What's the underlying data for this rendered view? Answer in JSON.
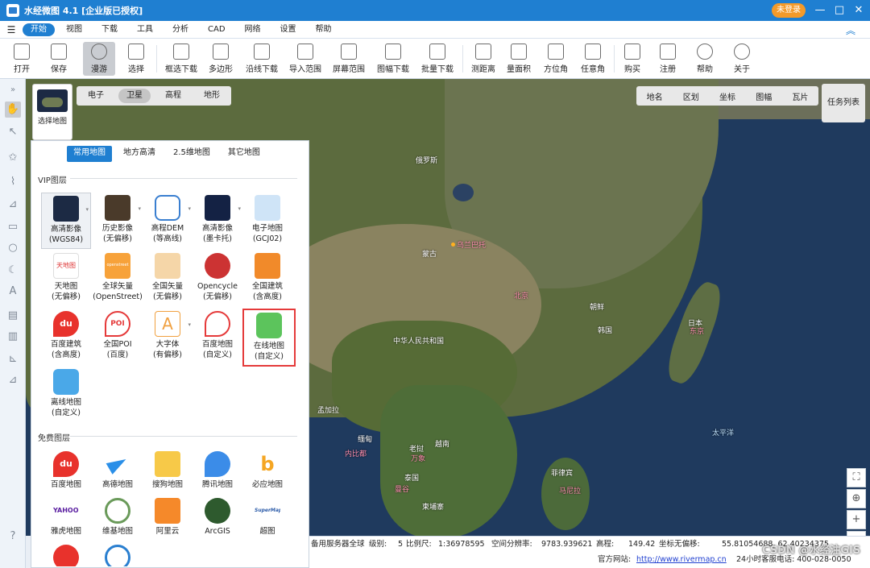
{
  "title": "水经微图 4.1 [企业版已授权]",
  "login": "未登录",
  "menu": [
    "开始",
    "视图",
    "下载",
    "工具",
    "分析",
    "CAD",
    "网络",
    "设置",
    "帮助"
  ],
  "toolbar": [
    "打开",
    "保存",
    "漫游",
    "选择",
    "框选下载",
    "多边形",
    "沿线下载",
    "导入范围",
    "屏幕范围",
    "图幅下载",
    "批量下载",
    "测距离",
    "量面积",
    "方位角",
    "任意角",
    "购买",
    "注册",
    "帮助",
    "关于"
  ],
  "map_tabs": [
    "电子",
    "卫星",
    "高程",
    "地形"
  ],
  "overlay_tabs": [
    "地名",
    "区划",
    "坐标",
    "图幅",
    "瓦片"
  ],
  "task_list": "任务列表",
  "choose_map": "选择地图",
  "panel_tabs": [
    "常用地图",
    "地方高清",
    "2.5维地图",
    "其它地图"
  ],
  "vip_title": "VIP图层",
  "free_title": "免费图层",
  "vip": [
    {
      "l1": "高清影像",
      "l2": "(WGS84)"
    },
    {
      "l1": "历史影像",
      "l2": "(无偏移)"
    },
    {
      "l1": "高程DEM",
      "l2": "(等高线)"
    },
    {
      "l1": "高清影像",
      "l2": "(墨卡托)"
    },
    {
      "l1": "电子地图",
      "l2": "(GCJ02)"
    },
    {
      "l1": "天地图",
      "l2": "(无偏移)"
    },
    {
      "l1": "全球矢量",
      "l2": "(OpenStreet)"
    },
    {
      "l1": "全国矢量",
      "l2": "(无偏移)"
    },
    {
      "l1": "Opencycle",
      "l2": "(无偏移)"
    },
    {
      "l1": "全国建筑",
      "l2": "(含高度)"
    },
    {
      "l1": "百度建筑",
      "l2": "(含高度)"
    },
    {
      "l1": "全国POI",
      "l2": "(百度)"
    },
    {
      "l1": "大字体",
      "l2": "(有偏移)"
    },
    {
      "l1": "百度地图",
      "l2": "(自定义)"
    },
    {
      "l1": "在线地图",
      "l2": "(自定义)"
    },
    {
      "l1": "离线地图",
      "l2": "(自定义)"
    }
  ],
  "vip_icon_text": {
    "tianditu": "天地图",
    "openstreet": "openstreet",
    "poi": "POI",
    "du": "du",
    "a": "A"
  },
  "free": [
    "百度地图",
    "高德地图",
    "搜狗地图",
    "腾讯地图",
    "必应地图",
    "雅虎地图",
    "维基地图",
    "阿里云",
    "ArcGIS",
    "超图"
  ],
  "free_icon_text": {
    "yahoo": "YAHOO!",
    "supermap": "SuperMap"
  },
  "map_labels": [
    "俄罗斯",
    "乌兰巴托",
    "蒙古",
    "北京",
    "朝鲜",
    "韩国",
    "日本",
    "东京",
    "中华人民共和国",
    "孟加拉",
    "缅甸",
    "老挝",
    "万象",
    "泰国",
    "曼谷",
    "柬埔寨",
    "菲律宾",
    "马尼拉",
    "太平洋",
    "内比都",
    "越南"
  ],
  "status": {
    "server": "备用服务器全球",
    "level_label": "级别:",
    "level": "5",
    "scale_label": "比例尺:",
    "scale": "1:36978595",
    "res_label": "空间分辨率:",
    "res": "9783.939621",
    "elev_label": "高程:",
    "elev": "149.42",
    "coord_label": "坐标无偏移:",
    "coord": "55.81054688, 62.40234375"
  },
  "bottom": {
    "site_label": "官方网站:",
    "site": "http://www.rivermap.cn",
    "phone": "24小时客服电话: 400-028-0050"
  },
  "watermark": "CSDN @水经注GIS"
}
